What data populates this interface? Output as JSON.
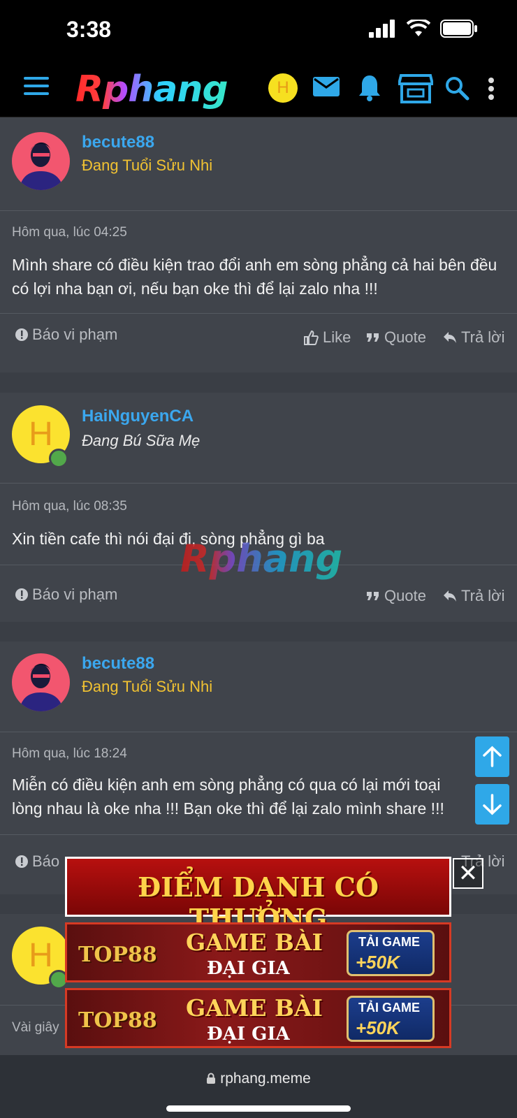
{
  "status": {
    "time": "3:38"
  },
  "header": {
    "logo": "Rphang",
    "avatar_letter": "H"
  },
  "posts": [
    {
      "username": "becute88",
      "title": "Đang Tuổi Sửu Nhi",
      "date": "Hôm qua, lúc 04:25",
      "text": "Mình share có điều kiện trao đổi anh em sòng phẳng cả hai bên đều có lợi nha bạn ơi, nếu bạn oke thì để lại zalo nha !!!",
      "report": "Báo vi phạm",
      "like": "Like",
      "quote": "Quote",
      "reply": "Trả lời"
    },
    {
      "username": "HaiNguyenCA",
      "avatar_letter": "H",
      "title": "Đang Bú Sữa Mẹ",
      "date": "Hôm qua, lúc 08:35",
      "text": "Xin tiền cafe thì nói đại đi, sòng phẳng gì ba",
      "report": "Báo vi phạm",
      "quote": "Quote",
      "reply": "Trả lời"
    },
    {
      "username": "becute88",
      "title": "Đang Tuổi Sửu Nhi",
      "date": "Hôm qua, lúc 18:24",
      "text": "Miễn có điều kiện anh em sòng phẳng có qua có lại mới toại lòng nhau là oke nha !!! Bạn oke thì để lại zalo mình share !!!",
      "report": "Báo",
      "reply": "Trả lời"
    },
    {
      "avatar_letter": "H",
      "date": "Vài giây"
    }
  ],
  "watermark": "Rphang",
  "ads": {
    "banner1": "ĐIỂM DANH CÓ THƯỞNG",
    "banner2": {
      "brand": "TOP88",
      "headline": "GAME BÀI",
      "sub": "ĐẠI GIA",
      "cta_line1": "TẢI GAME",
      "cta_line2": "+50K"
    },
    "banner3": {
      "brand": "TOP88",
      "headline": "GAME BÀI",
      "sub": "ĐẠI GIA",
      "cta_line1": "TẢI GAME",
      "cta_line2": "+50K"
    },
    "close": "✕"
  },
  "browser": {
    "url": "rphang.meme"
  },
  "colors": {
    "accent": "#2fa8e8",
    "username": "#3ba7ee",
    "usertitle": "#f1c232",
    "background": "#40444b"
  }
}
